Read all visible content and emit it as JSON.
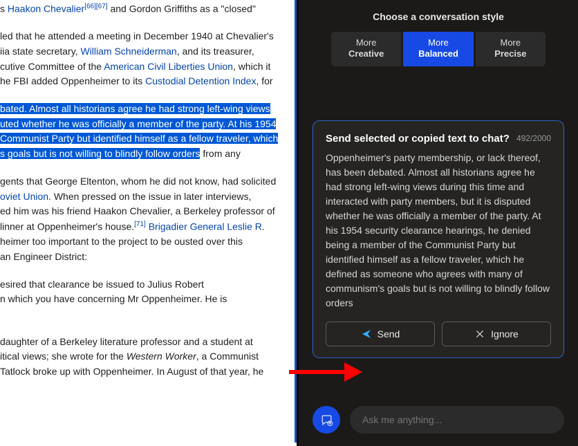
{
  "article": {
    "p1_pre": "s ",
    "p1_link1": "Haakon Chevalier",
    "p1_ref1": "[66]",
    "p1_ref2": "[67]",
    "p1_post": " and Gordon Griffiths as a \"closed\"",
    "p2_a": "led that he attended a meeting in December 1940 at Chevalier's",
    "p2_b_pre": "iia state secretary, ",
    "p2_b_link": "William Schneiderman",
    "p2_b_post": ", and its treasurer,",
    "p2_c_pre": "cutive Committee of the ",
    "p2_c_link": "American Civil Liberties Union",
    "p2_c_post": ", which it",
    "p2_d_pre": "he FBI added Oppenheimer to its ",
    "p2_d_link": "Custodial Detention Index",
    "p2_d_post": ", for",
    "hl_a": "bated. Almost all historians agree he had strong left-wing views",
    "hl_b": "uted whether he was officially a member of the party. At his 1954",
    "hl_c": "Communist Party but identified himself as a fellow traveler, which",
    "hl_d": "s goals but is not willing to blindly follow orders",
    "hl_trail": " from any",
    "p3_a": "gents that George Eltenton, whom he did not know, had solicited",
    "p3_b_link": "oviet Union",
    "p3_b_post": ". When pressed on the issue in later interviews,",
    "p3_c": "ed him was his friend Haakon Chevalier, a Berkeley professor of",
    "p3_d_pre": "linner at Oppenheimer's house.",
    "p3_d_ref": "[71]",
    "p3_d_link": " Brigadier General Leslie R.",
    "p3_e": "heimer too important to the project to be ousted over this",
    "p3_f": "an Engineer District:",
    "p4_a": "esired that clearance be issued to Julius Robert",
    "p4_b": "n which you have concerning Mr Oppenheimer. He is",
    "p5_a": "daughter of a Berkeley literature professor and a student at",
    "p5_b_pre": "itical views; she wrote for the ",
    "p5_b_em": "Western Worker",
    "p5_b_post": ", a Communist",
    "p5_c": "Tatlock broke up with Oppenheimer. In August of that year, he"
  },
  "sidebar": {
    "style_header": "Choose a conversation style",
    "styles": {
      "more": "More",
      "creative": "Creative",
      "balanced": "Balanced",
      "precise": "Precise"
    },
    "card": {
      "title": "Send selected or copied text to chat?",
      "count": "492/2000",
      "body": "Oppenheimer's party membership, or lack thereof, has been debated. Almost all historians agree he had strong left-wing views during this time and interacted with party members, but it is disputed whether he was officially a member of the party. At his 1954 security clearance hearings, he denied being a member of the Communist Party but identified himself as a fellow traveler, which he defined as someone who agrees with many of communism's goals but is not willing to blindly follow orders",
      "send": "Send",
      "ignore": "Ignore"
    },
    "input_placeholder": "Ask me anything..."
  }
}
